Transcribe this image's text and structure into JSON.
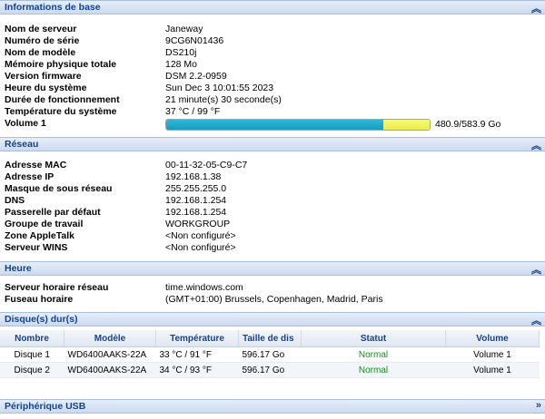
{
  "basic": {
    "title": "Informations de base",
    "rows": [
      {
        "label": "Nom de serveur",
        "value": "Janeway"
      },
      {
        "label": "Numéro de série",
        "value": "9CG6N01436"
      },
      {
        "label": "Nom de modèle",
        "value": "DS210j"
      },
      {
        "label": "Mémoire physique totale",
        "value": "128 Mo"
      },
      {
        "label": "Version firmware",
        "value": "DSM 2.2-0959"
      },
      {
        "label": "Heure du système",
        "value": "Sun Dec 3 10:01:55 2023"
      },
      {
        "label": "Durée de fonctionnement",
        "value": "21 minute(s) 30 seconde(s)"
      },
      {
        "label": "Température du système",
        "value": "37 °C / 99 °F"
      }
    ],
    "volume_label": "Volume 1",
    "volume_text": "480.9/583.9 Go",
    "volume_used_fraction": 0.824
  },
  "network": {
    "title": "Réseau",
    "rows": [
      {
        "label": "Adresse MAC",
        "value": "00-11-32-05-C9-C7"
      },
      {
        "label": "Adresse IP",
        "value": "192.168.1.38"
      },
      {
        "label": "Masque de sous réseau",
        "value": "255.255.255.0"
      },
      {
        "label": "DNS",
        "value": "192.168.1.254"
      },
      {
        "label": "Passerelle par défaut",
        "value": "192.168.1.254"
      },
      {
        "label": "Groupe de travail",
        "value": "WORKGROUP"
      },
      {
        "label": "Zone AppleTalk",
        "value": "<Non configuré>"
      },
      {
        "label": "Serveur WINS",
        "value": "<Non configuré>"
      }
    ]
  },
  "time": {
    "title": "Heure",
    "rows": [
      {
        "label": "Serveur horaire réseau",
        "value": "time.windows.com"
      },
      {
        "label": "Fuseau horaire",
        "value": "(GMT+01:00) Brussels, Copenhagen, Madrid, Paris"
      }
    ]
  },
  "disks": {
    "title": "Disque(s) dur(s)",
    "columns": [
      "Nombre",
      "Modèle",
      "Température",
      "Taille de dis",
      "Statut",
      "Volume"
    ],
    "rows": [
      {
        "name": "Disque 1",
        "model": "WD6400AAKS-22A",
        "temp": "33 °C / 91 °F",
        "size": "596.17 Go",
        "status": "Normal",
        "volume": "Volume 1"
      },
      {
        "name": "Disque 2",
        "model": "WD6400AAKS-22A",
        "temp": "34 °C / 93 °F",
        "size": "596.17 Go",
        "status": "Normal",
        "volume": "Volume 1"
      }
    ]
  },
  "usb": {
    "title": "Périphérique USB"
  },
  "icons": {
    "collapse": "double-chevron-up-icon",
    "expand": "double-chevron-right-icon"
  },
  "colors": {
    "header_text": "#15428b",
    "status_normal": "#198a1e",
    "bar_used": "#1a9cc0",
    "bar_free": "#e9ee4a"
  }
}
